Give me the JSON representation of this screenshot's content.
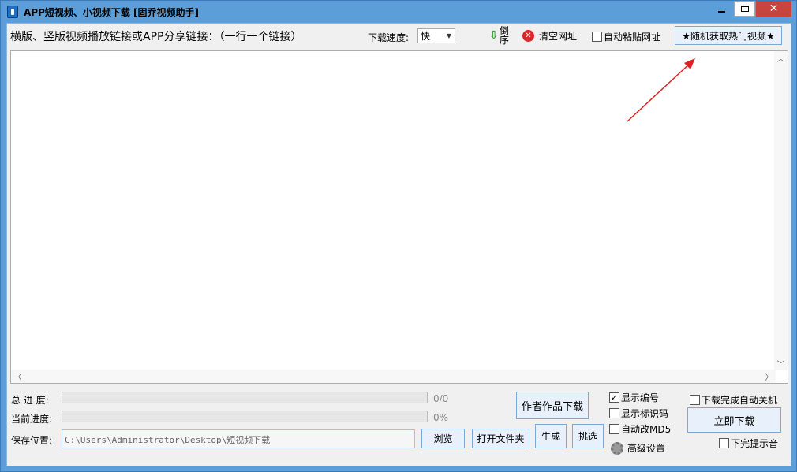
{
  "window": {
    "title": "APP短视频、小视频下载 [固乔视频助手]"
  },
  "header": {
    "links_label": "横版、竖版视频播放链接或APP分享链接：（一行一个链接）",
    "speed_label": "下载速度:",
    "speed_value": "快",
    "sort_label": "倒序",
    "clear_label": "清空网址",
    "auto_paste_label": "自动粘贴网址",
    "auto_paste_checked": false,
    "hot_video_label": "★随机获取热门视频★"
  },
  "link_input": {
    "value": ""
  },
  "progress": {
    "total_label": "总 进 度:",
    "total_value": "0/0",
    "total_fraction": 0,
    "current_label": "当前进度:",
    "current_value": "0%",
    "current_fraction": 0
  },
  "save": {
    "label": "保存位置:",
    "path": "C:\\Users\\Administrator\\Desktop\\短视频下载",
    "browse_label": "浏览",
    "open_folder_label": "打开文件夹"
  },
  "actions": {
    "author_download_label": "作者作品下载",
    "generate_label": "生成",
    "pick_label": "挑选",
    "download_now_label": "立即下载",
    "advanced_label": "高级设置"
  },
  "options": {
    "show_number_label": "显示编号",
    "show_number_checked": true,
    "show_id_label": "显示标识码",
    "show_id_checked": false,
    "auto_md5_label": "自动改MD5",
    "auto_md5_checked": false,
    "shutdown_label": "下载完成自动关机",
    "shutdown_checked": false,
    "done_sound_label": "下完提示音",
    "done_sound_checked": false
  },
  "colors": {
    "frame": "#5c9fd8",
    "close_button": "#c7453d",
    "annotation_arrow": "#e02020",
    "progress_fill": "#06b025"
  }
}
